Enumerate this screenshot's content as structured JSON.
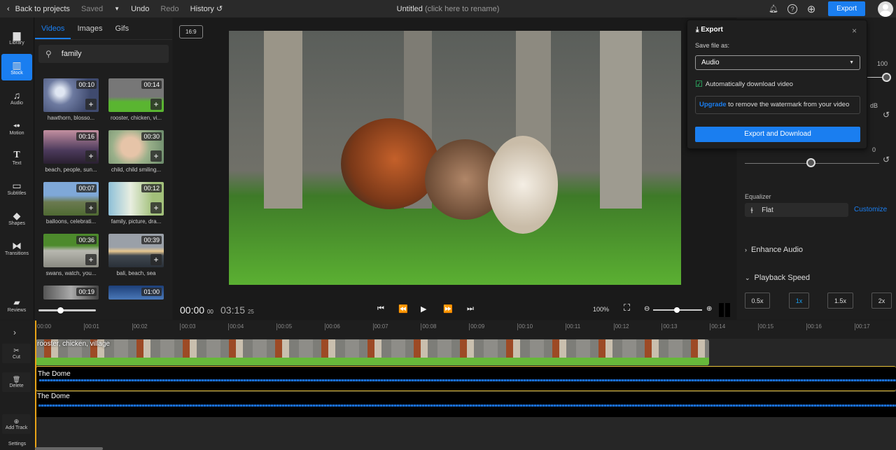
{
  "topbar": {
    "back": "Back to projects",
    "saved": "Saved",
    "undo": "Undo",
    "redo": "Redo",
    "history": "History",
    "title": "Untitled",
    "title_hint": "(click here to rename)",
    "export": "Export"
  },
  "rail": [
    {
      "label": "Library",
      "icon": "folder-icon",
      "glyph": "▆"
    },
    {
      "label": "Stock",
      "icon": "stock-icon",
      "glyph": "▥"
    },
    {
      "label": "Audio",
      "icon": "music-note-icon",
      "glyph": "♫"
    },
    {
      "label": "Motion",
      "icon": "motion-icon",
      "glyph": "◂●"
    },
    {
      "label": "Text",
      "icon": "text-icon",
      "glyph": "T"
    },
    {
      "label": "Subtitles",
      "icon": "subtitles-icon",
      "glyph": "▭"
    },
    {
      "label": "Shapes",
      "icon": "shapes-icon",
      "glyph": "◆"
    },
    {
      "label": "Transitions",
      "icon": "transitions-icon",
      "glyph": "⧓"
    },
    {
      "label": "Reviews",
      "icon": "reviews-icon",
      "glyph": "💬"
    }
  ],
  "panel": {
    "tabs": [
      "Videos",
      "Images",
      "Gifs"
    ],
    "active_tab": "Videos",
    "search_value": "family",
    "videos": [
      {
        "duration": "00:10",
        "label": "hawthorn, blosso..."
      },
      {
        "duration": "00:14",
        "label": "rooster, chicken, vi..."
      },
      {
        "duration": "00:16",
        "label": "beach, people, sun..."
      },
      {
        "duration": "00:30",
        "label": "child, child smiling..."
      },
      {
        "duration": "00:07",
        "label": "balloons, celebrati..."
      },
      {
        "duration": "00:12",
        "label": "family, picture, dra..."
      },
      {
        "duration": "00:36",
        "label": "swans, watch, you..."
      },
      {
        "duration": "00:39",
        "label": "bali, beach, sea"
      },
      {
        "duration": "00:19",
        "label": ""
      },
      {
        "duration": "01:00",
        "label": ""
      }
    ]
  },
  "stage": {
    "aspect": "16:9",
    "current_time": "00:00",
    "current_frame": "00",
    "total_time": "03:15",
    "total_frame": "25",
    "zoom": "100%"
  },
  "right": {
    "volume_value": "100",
    "volume_level": 1.0,
    "db_label": "dB",
    "pan_value": "0",
    "pan_level": 0.5,
    "equalizer_label": "Equalizer",
    "equalizer_value": "Flat",
    "customize": "Customize",
    "enhance_audio": "Enhance Audio",
    "playback_speed": "Playback Speed",
    "speeds": [
      "0.5x",
      "1x",
      "1.5x",
      "2x"
    ],
    "active_speed": "1x"
  },
  "export_modal": {
    "title": "Export",
    "save_as_label": "Save file as:",
    "format": "Audio",
    "auto_download": "Automatically download video",
    "upgrade_link": "Upgrade",
    "upgrade_text": " to remove the watermark from your video",
    "button": "Export and Download"
  },
  "timeline": {
    "tools": [
      "Cut",
      "Delete",
      "Add Track",
      "Settings"
    ],
    "ticks": [
      "00:00",
      "00:01",
      "00:02",
      "00:03",
      "00:04",
      "00:05",
      "00:06",
      "00:07",
      "00:08",
      "00:09",
      "00:10",
      "00:11",
      "00:12",
      "00:13",
      "00:14",
      "00:15",
      "00:16",
      "00:17"
    ],
    "video_track": "rooster, chicken, village",
    "audio_tracks": [
      "The Dome",
      "The Dome"
    ]
  }
}
